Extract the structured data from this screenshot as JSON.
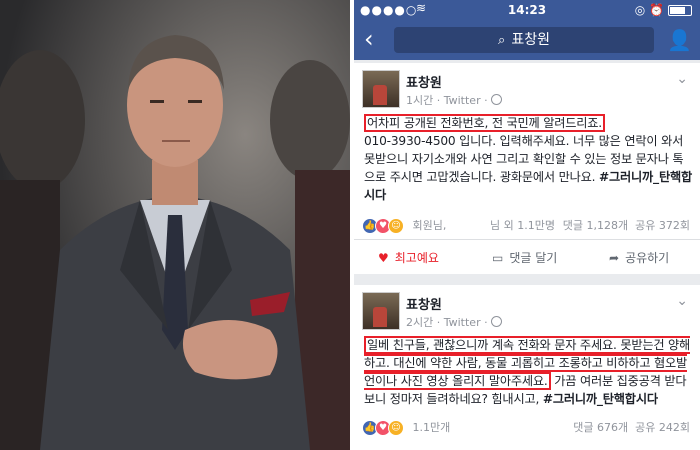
{
  "status_bar": {
    "signal": "●●●●○",
    "carrier": "KT",
    "time": "14:23",
    "right_icons": "◎ ⏰"
  },
  "nav": {
    "back_icon": "chevron-left-icon",
    "search_query": "표창원",
    "friends_icon": "friend-requests-icon"
  },
  "posts": [
    {
      "author": "표창원",
      "meta": "1시간 · Twitter ·",
      "body_highlight": "어차피 공개된 전화번호, 전 국민께 알려드리죠.",
      "body_rest": "010-3930-4500 입니다. 입력해주세요. 너무 많은 연락이 와서 못받으니 자기소개와 사연 그리고 확인할 수 있는 정보 문자나 톡으로 주시면 고맙겠습니다. 광화문에서 만나요.",
      "body_tag": "#그러니까_탄핵합시다",
      "reactions_left": "회원님,",
      "reactions_mid": "님 외 1.1만명",
      "comments": "댓글 1,128개",
      "shares": "공유 372회"
    },
    {
      "author": "표창원",
      "meta": "2시간 · Twitter ·",
      "body_highlight": "일베 친구들, 괜찮으니까 계속 전화와 문자 주세요. 못받는건 양해하고. 대신에 약한 사람, 동물 괴롭히고 조롱하고 비하하고 혐오발언이나 사진 영상 올리지 말아주세요.",
      "body_rest": "가끔 여러분 집중공격 받다보니 정마저 들려하네요? 힘내시고,",
      "body_tag": "#그러니까_탄핵합시다",
      "reactions_left": "1.1만개",
      "comments": "댓글 676개",
      "shares": "공유 242회"
    }
  ],
  "actions": {
    "like": "최고예요",
    "comment": "댓글 달기",
    "share": "공유하기"
  },
  "colors": {
    "facebook_blue": "#3b5998",
    "highlight_red": "#e8202a"
  }
}
